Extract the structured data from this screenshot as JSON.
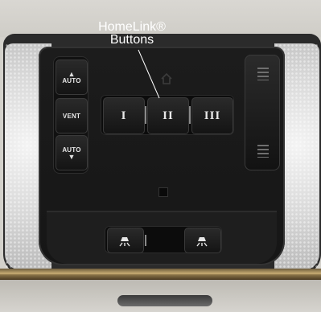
{
  "callout": {
    "line1": "HomeLink®",
    "line2": "Buttons"
  },
  "sunshade_buttons": [
    {
      "label": "AUTO",
      "arrow": "▲"
    },
    {
      "label": "VENT",
      "arrow": ""
    },
    {
      "label": "AUTO",
      "arrow": "▼"
    }
  ],
  "homelink_buttons": [
    {
      "label": "I"
    },
    {
      "label": "II"
    },
    {
      "label": "III"
    }
  ],
  "icons": {
    "home": "home-icon",
    "map_lamp_left": "map-lamp-left-icon",
    "map_lamp_right": "map-lamp-right-icon"
  },
  "colors": {
    "console": "#1a1a1a",
    "button_text": "#e8e8e8",
    "trim_chrome": "#c9ad74"
  }
}
